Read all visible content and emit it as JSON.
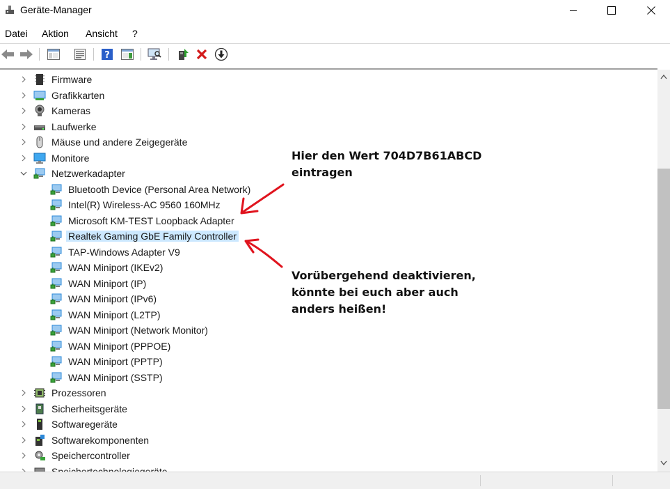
{
  "window": {
    "title": "Geräte-Manager"
  },
  "menu": [
    "Datei",
    "Aktion",
    "Ansicht",
    "?"
  ],
  "toolbar": [
    {
      "name": "back-icon"
    },
    {
      "name": "forward-icon"
    },
    {
      "name": "show-hide-console-tree-icon"
    },
    {
      "name": "properties-icon"
    },
    {
      "name": "help-icon"
    },
    {
      "name": "action-pane-icon"
    },
    {
      "name": "scan-hardware-icon"
    },
    {
      "name": "update-driver-icon"
    },
    {
      "name": "uninstall-device-icon"
    },
    {
      "name": "disable-device-icon"
    }
  ],
  "tree": [
    {
      "label": "Firmware",
      "level": 0,
      "expander": "collapsed",
      "icon": "firmware-icon"
    },
    {
      "label": "Grafikkarten",
      "level": 0,
      "expander": "collapsed",
      "icon": "display-adapter-icon"
    },
    {
      "label": "Kameras",
      "level": 0,
      "expander": "collapsed",
      "icon": "camera-icon"
    },
    {
      "label": "Laufwerke",
      "level": 0,
      "expander": "collapsed",
      "icon": "disk-drive-icon"
    },
    {
      "label": "Mäuse und andere Zeigegeräte",
      "level": 0,
      "expander": "collapsed",
      "icon": "mouse-icon"
    },
    {
      "label": "Monitore",
      "level": 0,
      "expander": "collapsed",
      "icon": "monitor-icon"
    },
    {
      "label": "Netzwerkadapter",
      "level": 0,
      "expander": "expanded",
      "icon": "network-adapter-icon"
    },
    {
      "label": "Bluetooth Device (Personal Area Network)",
      "level": 1,
      "icon": "network-adapter-icon"
    },
    {
      "label": "Intel(R) Wireless-AC 9560 160MHz",
      "level": 1,
      "icon": "network-adapter-icon"
    },
    {
      "label": "Microsoft KM-TEST Loopback Adapter",
      "level": 1,
      "icon": "network-adapter-icon"
    },
    {
      "label": "Realtek Gaming GbE Family Controller",
      "level": 1,
      "icon": "network-adapter-icon",
      "selected": true
    },
    {
      "label": "TAP-Windows Adapter V9",
      "level": 1,
      "icon": "network-adapter-icon"
    },
    {
      "label": "WAN Miniport (IKEv2)",
      "level": 1,
      "icon": "network-adapter-icon"
    },
    {
      "label": "WAN Miniport (IP)",
      "level": 1,
      "icon": "network-adapter-icon"
    },
    {
      "label": "WAN Miniport (IPv6)",
      "level": 1,
      "icon": "network-adapter-icon"
    },
    {
      "label": "WAN Miniport (L2TP)",
      "level": 1,
      "icon": "network-adapter-icon"
    },
    {
      "label": "WAN Miniport (Network Monitor)",
      "level": 1,
      "icon": "network-adapter-icon"
    },
    {
      "label": "WAN Miniport (PPPOE)",
      "level": 1,
      "icon": "network-adapter-icon"
    },
    {
      "label": "WAN Miniport (PPTP)",
      "level": 1,
      "icon": "network-adapter-icon"
    },
    {
      "label": "WAN Miniport (SSTP)",
      "level": 1,
      "icon": "network-adapter-icon"
    },
    {
      "label": "Prozessoren",
      "level": 0,
      "expander": "collapsed",
      "icon": "processor-icon"
    },
    {
      "label": "Sicherheitsgeräte",
      "level": 0,
      "expander": "collapsed",
      "icon": "security-device-icon"
    },
    {
      "label": "Softwaregeräte",
      "level": 0,
      "expander": "collapsed",
      "icon": "software-device-icon"
    },
    {
      "label": "Softwarekomponenten",
      "level": 0,
      "expander": "collapsed",
      "icon": "software-component-icon"
    },
    {
      "label": "Speichercontroller",
      "level": 0,
      "expander": "collapsed",
      "icon": "storage-controller-icon"
    },
    {
      "label": "Speichertechnologiegeräte",
      "level": 0,
      "expander": "collapsed",
      "icon": "storage-technology-icon"
    }
  ],
  "annotations": {
    "top": [
      "Hier den Wert 704D7B61ABCD",
      "eintragen"
    ],
    "bottom": [
      "Vorübergehend deaktivieren,",
      "könnte bei euch aber auch",
      "anders heißen!"
    ]
  },
  "colors": {
    "selection": "#cce8ff",
    "arrow": "#e0141e",
    "scroll_thumb": "#c1c1c1"
  }
}
